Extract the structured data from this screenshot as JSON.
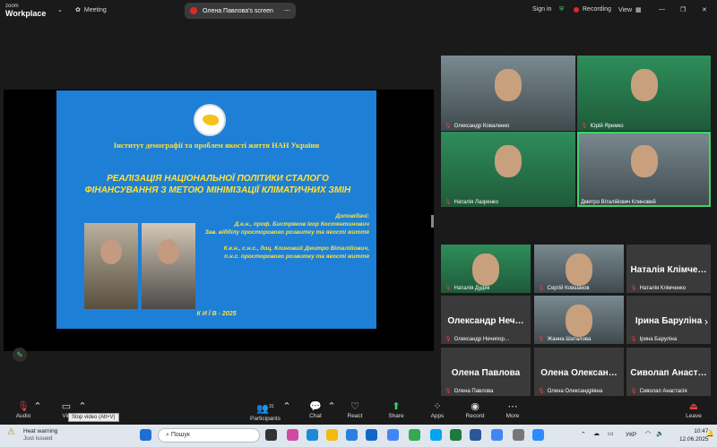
{
  "app": {
    "brand_small": "zoom",
    "brand": "Workplace",
    "meeting": "Meeting"
  },
  "share": {
    "label": "Олена Павлова's screen"
  },
  "top_right": {
    "signin": "Sign in",
    "recording": "Recording",
    "view": "View"
  },
  "slide": {
    "institute": "Інститут демографії та проблем якості життя НАН України",
    "title_line1": "РЕАЛІЗАЦІЯ НАЦІОНАЛЬНОЇ ПОЛІТИКИ  СТАЛОГО",
    "title_line2": "ФІНАНСУВАННЯ З МЕТОЮ МІНІМІЗАЦІЇ КЛІМАТИЧНИХ ЗМІН",
    "reporters": "Доповідачі:",
    "rep1a": "Д.е.н., проф. Бистряков Ігор Костянтинович",
    "rep1b": "Зав. відділу просторового розвитку та якості життя",
    "rep2a": "К.е.н., с.н.с., доц. Клиновий Дмитро Віталійович,",
    "rep2b": "п.н.с. просторового розвитку та якості життя",
    "city": "К И Ї В - 2025"
  },
  "tiles_top": [
    {
      "name": "Олександр Коваленко"
    },
    {
      "name": "Юрій Яремко"
    },
    {
      "name": "Наталія Лазренко"
    },
    {
      "name": "Дмитро Віталійович Клиновий"
    }
  ],
  "tiles_grid": [
    {
      "name": "Наталія Дудяк",
      "big": ""
    },
    {
      "name": "Сергій Ковшаков",
      "big": ""
    },
    {
      "name": "Наталія Клімченко",
      "big": "Наталія Клімче…"
    },
    {
      "name": "Олександр Нечипор…",
      "big": "Олександр Неч…"
    },
    {
      "name": "Жанна Шаталова",
      "big": ""
    },
    {
      "name": "Ірина Баруліна",
      "big": "Ірина Баруліна"
    },
    {
      "name": "Олена Павлова",
      "big": "Олена Павлова"
    },
    {
      "name": "Олена Олександрівна",
      "big": "Олена Олексан…"
    },
    {
      "name": "Сиволап Анастасія",
      "big": "Сиволап Анаст…"
    }
  ],
  "toolbar": {
    "audio": "Audio",
    "video": "Vid",
    "participants": "Participants",
    "participants_count": "31",
    "chat": "Chat",
    "react": "React",
    "share": "Share",
    "apps": "Apps",
    "record": "Record",
    "more": "More",
    "leave": "Leave",
    "tooltip": "Stop video (Alt+V)"
  },
  "taskbar": {
    "weather_title": "Heat warning",
    "weather_sub": "Just issued",
    "search": "Пошук",
    "lang": "УКР",
    "time": "10:47",
    "date": "12.06.2025"
  }
}
